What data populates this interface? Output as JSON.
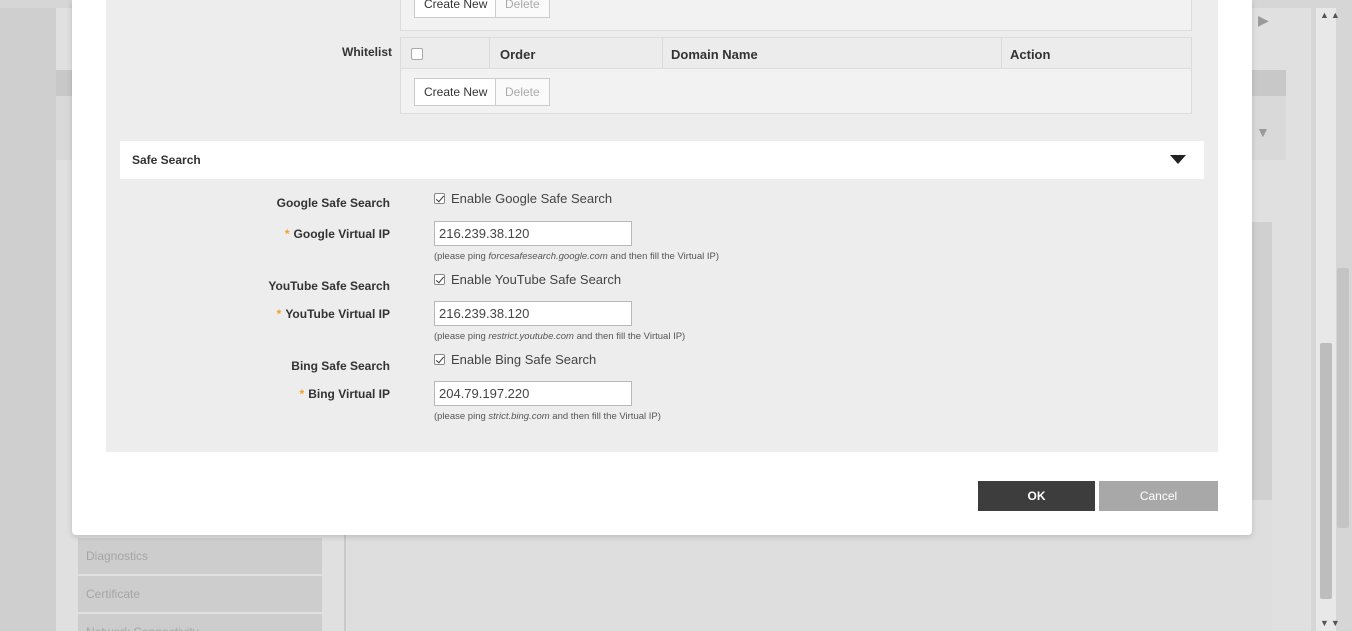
{
  "background": {
    "sidebar_items": [
      "Diagnostics",
      "Certificate",
      "Network Connectivity"
    ]
  },
  "blacklist": {
    "buttons": {
      "create_new": "Create New",
      "delete": "Delete"
    }
  },
  "whitelist": {
    "label": "Whitelist",
    "columns": [
      "Order",
      "Domain Name",
      "Action"
    ],
    "buttons": {
      "create_new": "Create New",
      "delete": "Delete"
    }
  },
  "safe_search": {
    "title": "Safe Search",
    "google": {
      "label": "Google Safe Search",
      "checkbox_label": "Enable Google Safe Search",
      "enabled": true,
      "ip_label": "Google Virtual IP",
      "ip_value": "216.239.38.120",
      "hint_prefix": "(please ping ",
      "hint_domain": "forcesafesearch.google.com",
      "hint_suffix": " and then fill the Virtual IP)"
    },
    "youtube": {
      "label": "YouTube Safe Search",
      "checkbox_label": "Enable YouTube Safe Search",
      "enabled": true,
      "ip_label": "YouTube Virtual IP",
      "ip_value": "216.239.38.120",
      "hint_prefix": "(please ping ",
      "hint_domain": "restrict.youtube.com",
      "hint_suffix": " and then fill the Virtual IP)"
    },
    "bing": {
      "label": "Bing Safe Search",
      "checkbox_label": "Enable Bing Safe Search",
      "enabled": true,
      "ip_label": "Bing Virtual IP",
      "ip_value": "204.79.197.220",
      "hint_prefix": "(please ping ",
      "hint_domain": "strict.bing.com",
      "hint_suffix": " and then fill the Virtual IP)"
    },
    "required_marker": "*"
  },
  "footer": {
    "ok_label": "OK",
    "cancel_label": "Cancel"
  },
  "colors": {
    "ok_bg": "#3d3d3d",
    "cancel_bg": "#a8a8a8",
    "required": "#f0a030"
  },
  "icons": {
    "section_toggle": "caret-down-icon",
    "scroll_up": "scroll-up-icon",
    "scroll_down": "scroll-down-icon"
  }
}
